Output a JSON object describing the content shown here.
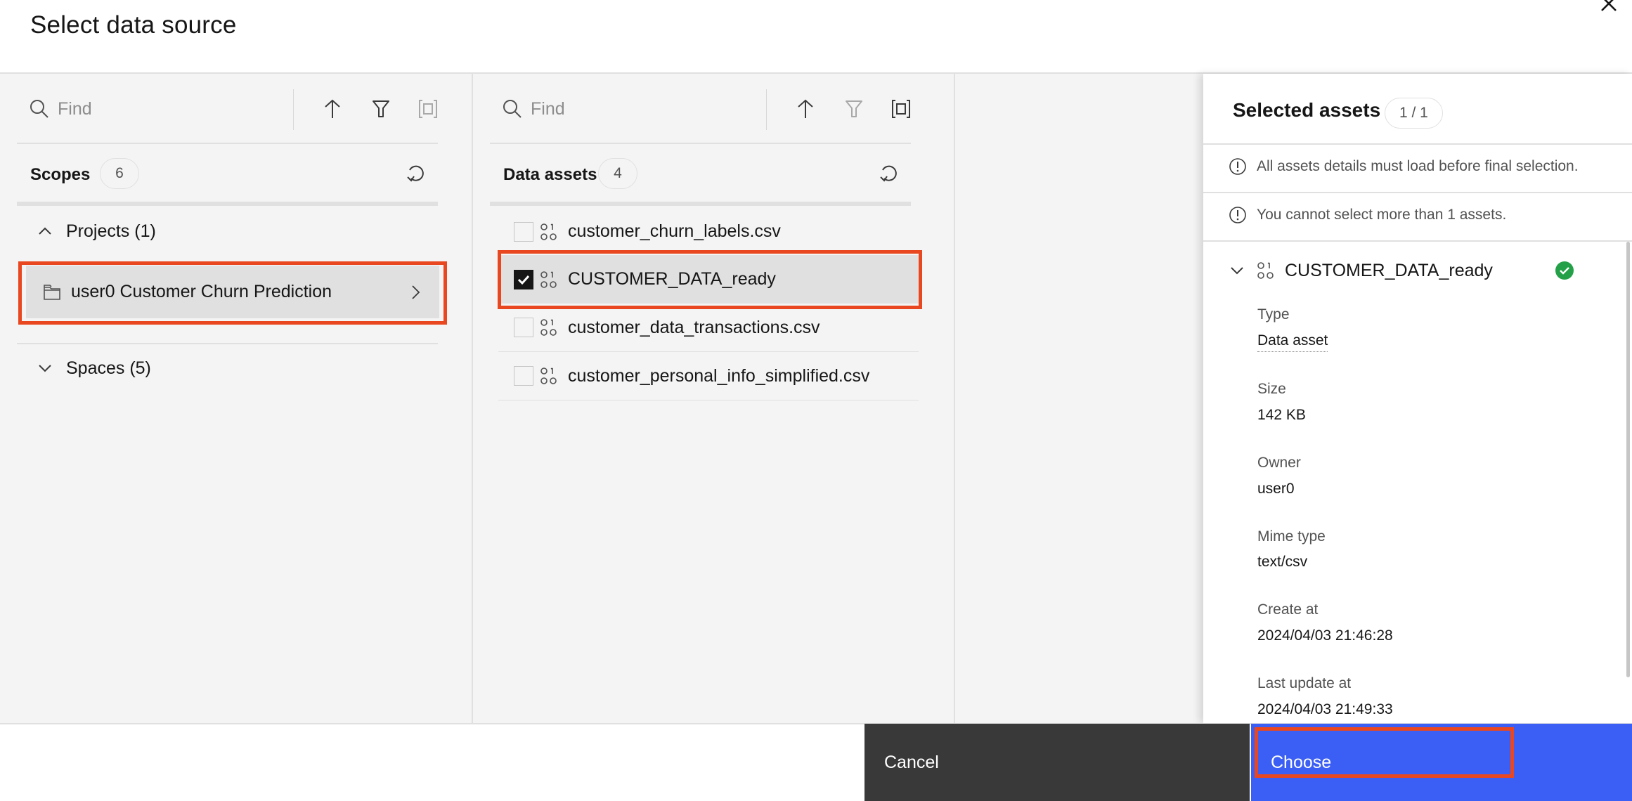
{
  "dialog": {
    "title": "Select data source",
    "close_icon": "close-icon"
  },
  "scopes_panel": {
    "search_placeholder": "Find",
    "search_value": "",
    "toolbar_icons": [
      "sort-ascending-icon",
      "filter-icon",
      "fit-to-screen-icon"
    ],
    "header": "Scopes",
    "count": "6",
    "refresh_icon": "refresh-icon",
    "groups": [
      {
        "label": "Projects (1)",
        "expanded": true,
        "items": [
          {
            "label": "user0 Customer Churn Prediction",
            "icon": "folder-icon",
            "selected": true
          }
        ]
      },
      {
        "label": "Spaces (5)",
        "expanded": false,
        "items": []
      }
    ]
  },
  "assets_panel": {
    "search_placeholder": "Find",
    "search_value": "",
    "toolbar_icons": [
      "sort-ascending-icon",
      "filter-icon",
      "fit-to-screen-icon"
    ],
    "header": "Data assets",
    "count": "4",
    "refresh_icon": "refresh-icon",
    "items": [
      {
        "name": "customer_churn_labels.csv",
        "checked": false
      },
      {
        "name": "CUSTOMER_DATA_ready",
        "checked": true
      },
      {
        "name": "customer_data_transactions.csv",
        "checked": false
      },
      {
        "name": "customer_personal_info_simplified.csv",
        "checked": false
      }
    ]
  },
  "selected_panel": {
    "title": "Selected assets",
    "count": "1 / 1",
    "warnings": [
      "All assets details must load before final selection.",
      "You cannot select more than 1 assets."
    ],
    "asset": {
      "name": "CUSTOMER_DATA_ready",
      "status": "loaded",
      "details": [
        {
          "label": "Type",
          "value": "Data asset"
        },
        {
          "label": "Size",
          "value": "142 KB"
        },
        {
          "label": "Owner",
          "value": "user0"
        },
        {
          "label": "Mime type",
          "value": "text/csv"
        },
        {
          "label": "Create at",
          "value": "2024/04/03 21:46:28"
        },
        {
          "label": "Last update at",
          "value": "2024/04/03 21:49:33"
        }
      ]
    }
  },
  "footer": {
    "cancel_label": "Cancel",
    "choose_label": "Choose"
  },
  "colors": {
    "primary": "#3b5ff5",
    "secondary_button": "#393939",
    "highlight": "#e8471f",
    "success": "#24a148"
  }
}
